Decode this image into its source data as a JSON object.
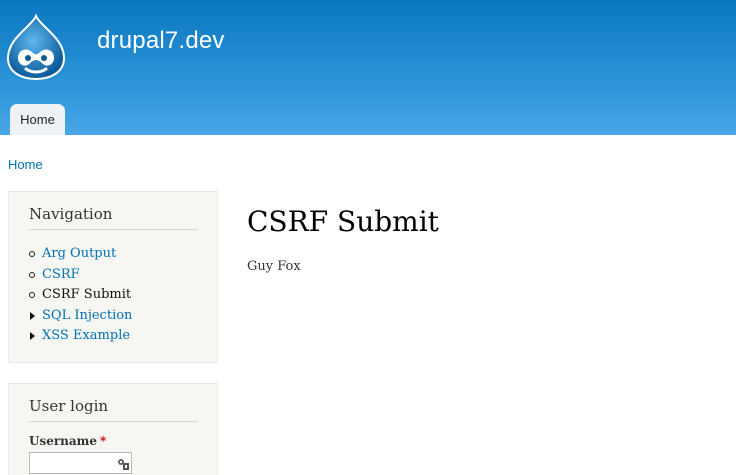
{
  "header": {
    "site_name": "drupal7.dev",
    "logo_icon": "drupal-drop-icon",
    "tabs": [
      {
        "label": "Home",
        "active": true
      }
    ]
  },
  "breadcrumb": {
    "items": [
      "Home"
    ]
  },
  "sidebar": {
    "navigation": {
      "title": "Navigation",
      "items": [
        {
          "label": "Arg Output",
          "bullet": "circle",
          "active": false
        },
        {
          "label": "CSRF",
          "bullet": "circle",
          "active": false
        },
        {
          "label": "CSRF Submit",
          "bullet": "circle",
          "active": true
        },
        {
          "label": "SQL Injection",
          "bullet": "triangle",
          "active": false
        },
        {
          "label": "XSS Example",
          "bullet": "triangle",
          "active": false
        }
      ]
    },
    "user_login": {
      "title": "User login",
      "username_label": "Username",
      "required_marker": "*",
      "username_value": ""
    }
  },
  "main": {
    "title": "CSRF Submit",
    "body": "Guy Fox"
  },
  "colors": {
    "header_top": "#0a77c0",
    "header_bottom": "#47a6e6",
    "link": "#0071b3",
    "sidebar_bg": "#f6f6f2",
    "required": "#cc0000"
  }
}
